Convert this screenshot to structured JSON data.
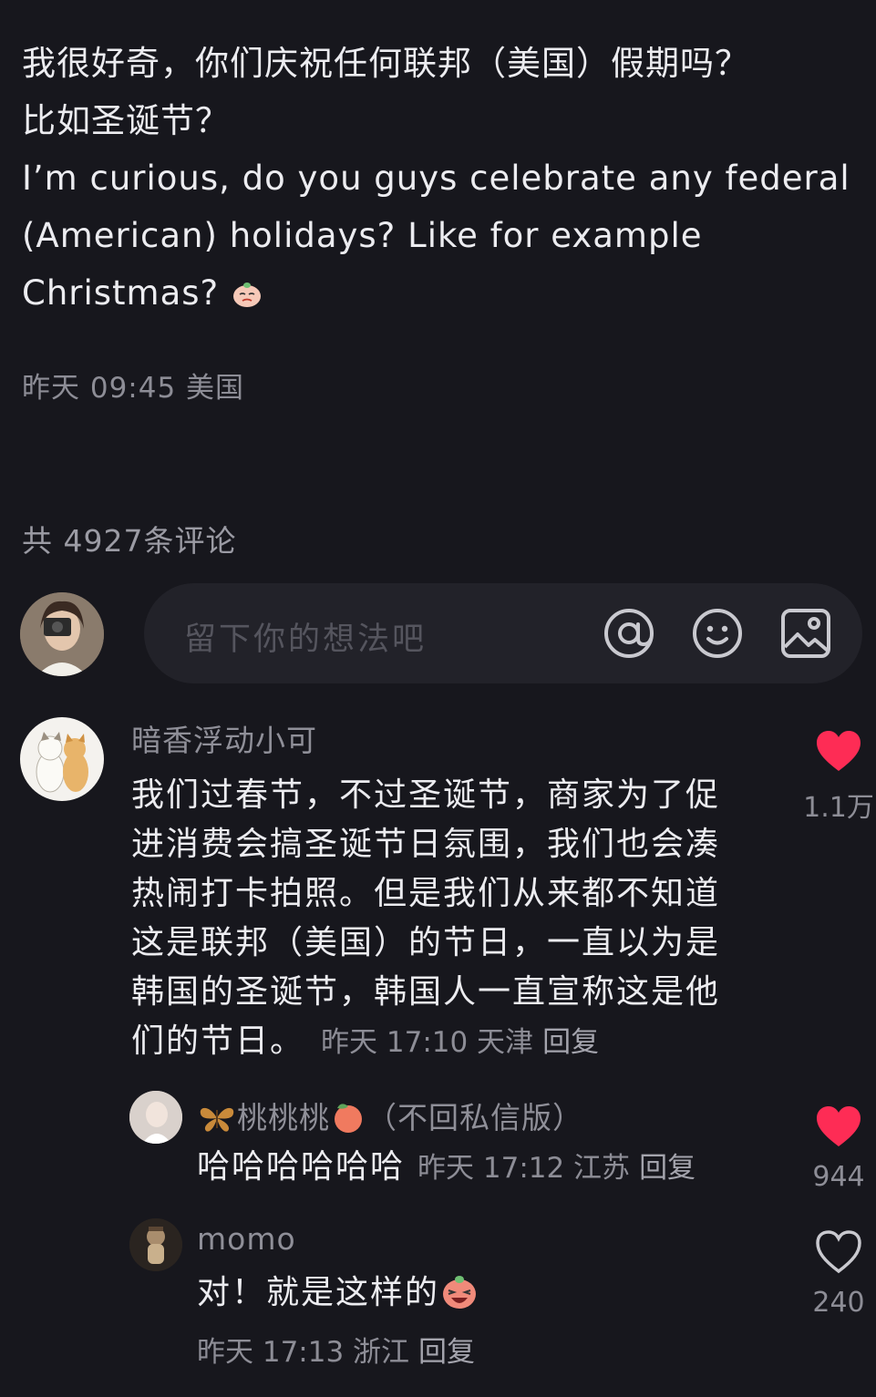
{
  "post": {
    "lines_cn": [
      "我很好奇，你们庆祝任何联邦（美国）假期吗？",
      "比如圣诞节？"
    ],
    "lines_en": [
      "I’m curious, do you guys celebrate any federal",
      "(American) holidays? Like for example",
      "Christmas?"
    ],
    "emoji": "smug-face-emoji",
    "meta": "昨天 09:45 美国"
  },
  "comments_header": {
    "count_label": "共 4927条评论"
  },
  "composer": {
    "placeholder": "留下你的想法吧",
    "icons": [
      "at-icon",
      "smiley-icon",
      "image-icon"
    ]
  },
  "comments": [
    {
      "username": "暗香浮动小可",
      "lines": [
        "我们过春节，不过圣诞节，商家为了促",
        "进消费会搞圣诞节日氛围，我们也会凑",
        "热闹打卡拍照。但是我们从来都不知道",
        "这是联邦（美国）的节日，一直以为是",
        "韩国的圣诞节，韩国人一直宣称这是他",
        "们的节日。"
      ],
      "meta": "昨天 17:10 天津",
      "reply": "回复",
      "likes": "1.1万",
      "liked": true,
      "replies": [
        {
          "username": "桃桃桃",
          "username_suffix": "（不回私信版）",
          "text": "哈哈哈哈哈哈",
          "meta": "昨天 17:12 江苏",
          "reply": "回复",
          "likes": "944",
          "liked": true
        },
        {
          "username": "momo",
          "text": "对！就是这样的",
          "meta": "昨天 17:13 浙江",
          "reply": "回复",
          "likes": "240",
          "liked": false
        }
      ]
    }
  ],
  "colors": {
    "background": "#17171d",
    "like_red": "#fe2c55",
    "muted_text": "#8d8d96"
  }
}
